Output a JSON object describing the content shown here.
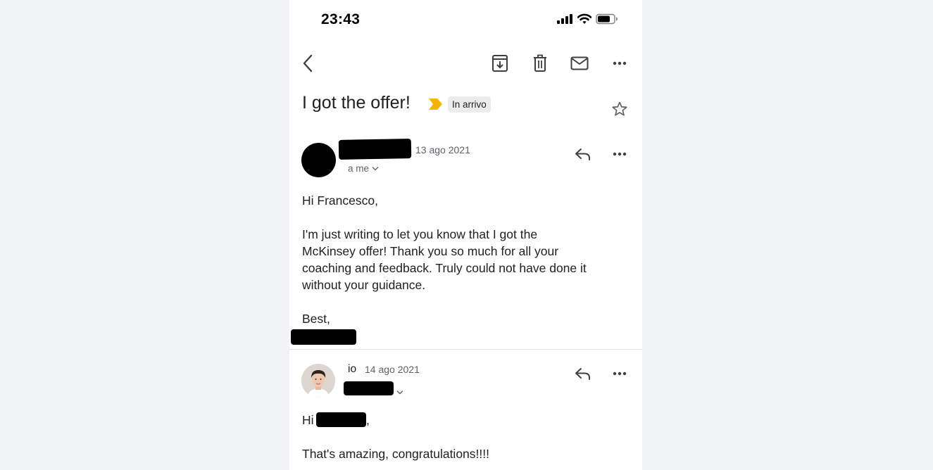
{
  "status_bar": {
    "time": "23:43",
    "icons": [
      "cellular-signal-icon",
      "wifi-icon",
      "battery-icon"
    ]
  },
  "toolbar": {
    "icons": [
      "back-arrow-icon",
      "archive-icon",
      "delete-icon",
      "mark-unread-icon",
      "more-options-icon"
    ]
  },
  "email": {
    "subject": "I got the offer!",
    "label": "In arrivo",
    "importance_color": "#f4b400"
  },
  "messages": [
    {
      "date": "13 ago 2021",
      "to": "a me",
      "body": {
        "greeting": "Hi Francesco,",
        "paragraph": [
          "I'm just writing to let you know that I got the",
          "McKinsey offer! Thank you so much for all your",
          "coaching and feedback. Truly could not have done it",
          "without your guidance."
        ],
        "signoff": "Best,"
      }
    },
    {
      "sender": "io",
      "date": "14 ago 2021",
      "body": {
        "greeting_prefix": "Hi",
        "greeting_suffix": ",",
        "line": "That's amazing, congratulations!!!!"
      }
    }
  ]
}
